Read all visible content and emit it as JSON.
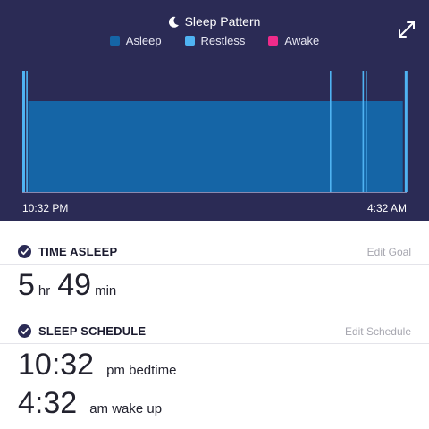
{
  "chart": {
    "title": "Sleep Pattern",
    "legend": [
      {
        "label": "Asleep",
        "color": "#1565a6"
      },
      {
        "label": "Restless",
        "color": "#4fb3f2"
      },
      {
        "label": "Awake",
        "color": "#ef2b8a"
      }
    ],
    "start_label": "10:32 PM",
    "end_label": "4:32 AM",
    "expand_icon": "expand-icon",
    "moon_icon": "moon-icon"
  },
  "chart_data": {
    "type": "bar",
    "x_range": [
      "10:32 PM",
      "4:32 AM"
    ],
    "series": [
      {
        "name": "Asleep",
        "segments": [
          {
            "start_fraction": 0.015,
            "end_fraction": 0.99
          }
        ]
      },
      {
        "name": "Restless",
        "events_fraction": [
          0.0,
          0.01,
          0.8,
          0.885,
          0.893,
          0.995
        ]
      },
      {
        "name": "Awake",
        "events_fraction": []
      }
    ],
    "colors": {
      "background": "#2b2b55",
      "asleep": "#1565a6",
      "restless": "#4fb3f2",
      "awake": "#ef2b8a"
    }
  },
  "time_asleep": {
    "title": "TIME ASLEEP",
    "action": "Edit Goal",
    "hours": "5",
    "hours_unit": "hr",
    "minutes": "49",
    "minutes_unit": "min"
  },
  "sleep_schedule": {
    "title": "SLEEP SCHEDULE",
    "action": "Edit Schedule",
    "bedtime": "10:32",
    "bedtime_suffix": "pm bedtime",
    "wake": "4:32",
    "wake_suffix": "am wake up"
  }
}
